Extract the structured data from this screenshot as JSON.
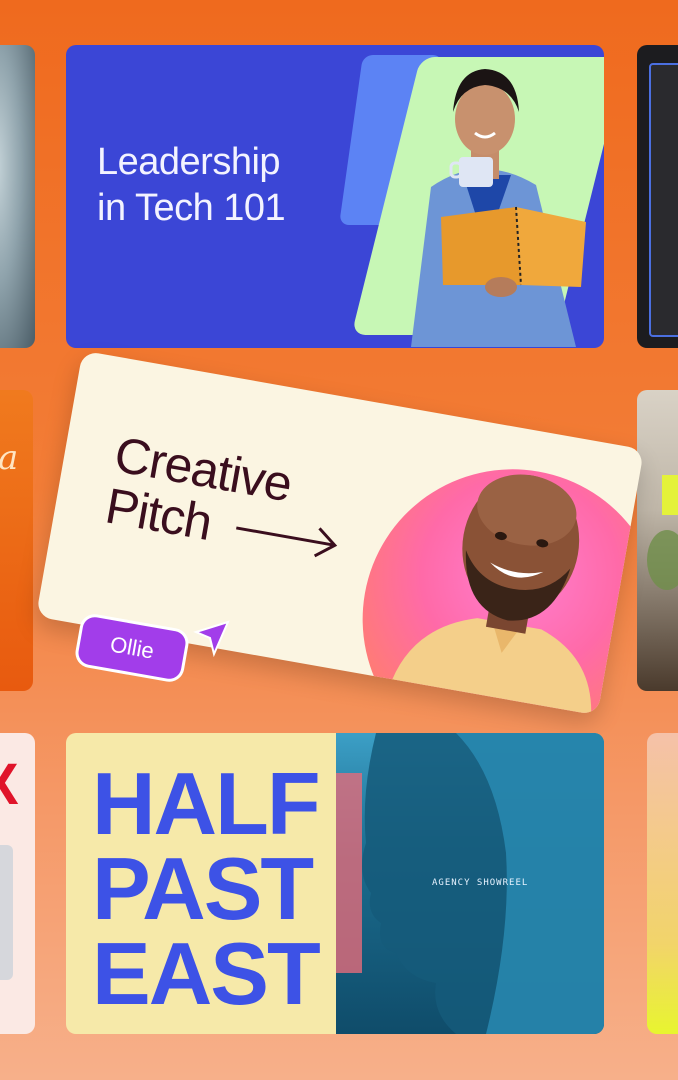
{
  "cards": {
    "leadership": {
      "title_line1": "Leadership",
      "title_line2": "in Tech 101"
    },
    "pitch": {
      "title_line1": "Creative",
      "title_line2": "Pitch",
      "tag": "Ollie"
    },
    "halfpast": {
      "line1": "HALF",
      "line2": "PAST",
      "line3": "EAST",
      "tagline": "AGENCY SHOWREEL"
    }
  },
  "colors": {
    "background": "#ef6a1e",
    "leadership_bg": "#3b46d6",
    "pitch_bg": "#fbf5e2",
    "ollie_tag": "#a23dea",
    "halfpast_bg": "#f6e9a9",
    "halfpast_text": "#3d52e6"
  },
  "icons": [
    "arrow-right-icon",
    "cursor-pointer-icon",
    "tea-cup-icon",
    "notebook-icon"
  ]
}
